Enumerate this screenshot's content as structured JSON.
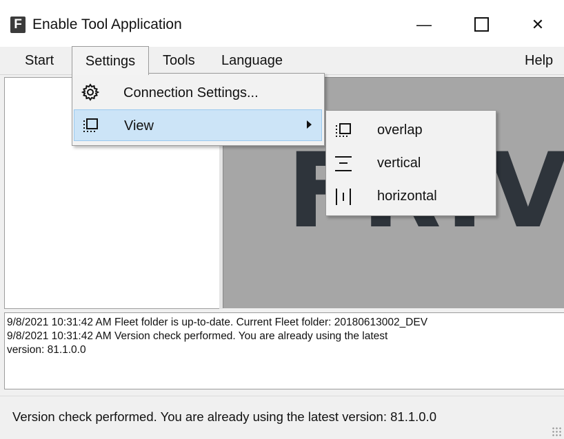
{
  "window": {
    "title": "Enable Tool Application",
    "app_icon_letter": "F",
    "buttons": {
      "minimize": "—",
      "maximize": "maximize-icon",
      "close": "✕"
    }
  },
  "menubar": {
    "items": [
      {
        "label": "Start"
      },
      {
        "label": "Settings",
        "state": "open"
      },
      {
        "label": "Tools"
      },
      {
        "label": "Language"
      },
      {
        "label": "Help"
      }
    ]
  },
  "settings_menu": {
    "items": [
      {
        "label": "Connection Settings...",
        "icon": "gear-icon"
      },
      {
        "label": "View",
        "icon": "window-view-icon",
        "has_submenu": true,
        "highlighted": true
      }
    ]
  },
  "view_submenu": {
    "items": [
      {
        "label": "overlap",
        "icon": "overlap-icon"
      },
      {
        "label": "vertical",
        "icon": "vertical-icon"
      },
      {
        "label": "horizontal",
        "icon": "horizontal-icon"
      }
    ]
  },
  "logo": {
    "text": "FRIVO"
  },
  "log": {
    "lines": [
      "9/8/2021 10:31:42 AM Fleet folder is up-to-date. Current Fleet folder: 20180613002_DEV",
      "9/8/2021 10:31:42 AM Version check performed. You are already using the latest",
      "version: 81.1.0.0"
    ]
  },
  "statusbar": {
    "text": "Version check performed. You are already using the latest version: 81.1.0.0"
  },
  "colors": {
    "highlight": "#cce4f7",
    "logo_background": "#a6a6a6",
    "logo_text": "#2e343b"
  }
}
